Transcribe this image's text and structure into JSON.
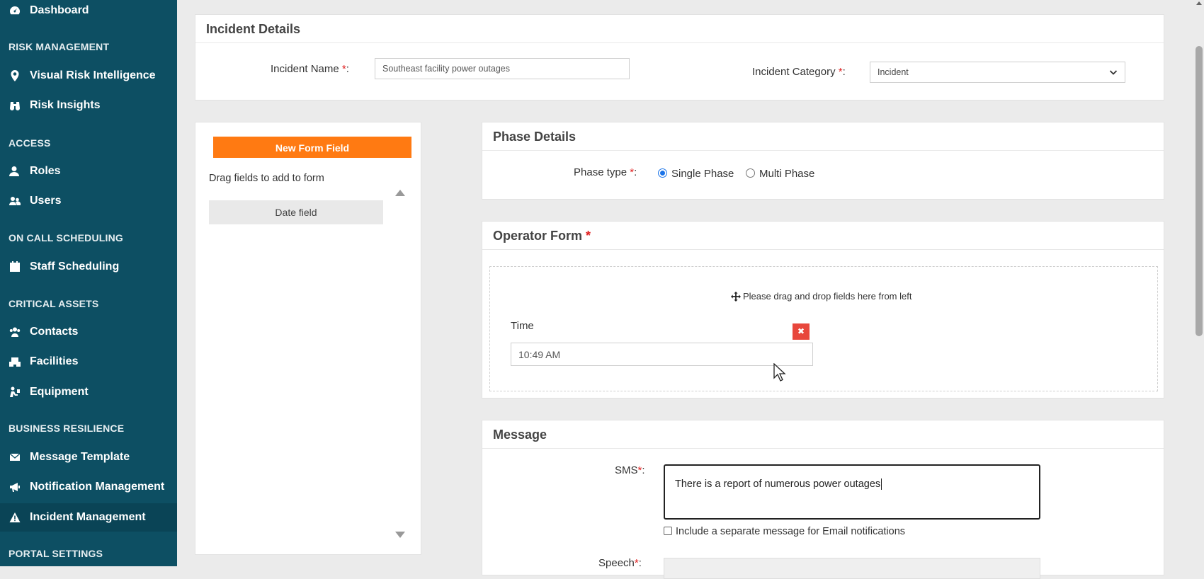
{
  "sidebar": {
    "items": [
      {
        "label": "Dashboard",
        "icon": "dashboard-icon"
      },
      {
        "label": "Visual Risk Intelligence",
        "icon": "map-pin-icon"
      },
      {
        "label": "Risk Insights",
        "icon": "binoculars-icon"
      },
      {
        "label": "Roles",
        "icon": "user-icon"
      },
      {
        "label": "Users",
        "icon": "users-icon"
      },
      {
        "label": "Staff Scheduling",
        "icon": "calendar-icon"
      },
      {
        "label": "Contacts",
        "icon": "contacts-icon"
      },
      {
        "label": "Facilities",
        "icon": "building-icon"
      },
      {
        "label": "Equipment",
        "icon": "equipment-icon"
      },
      {
        "label": "Message Template",
        "icon": "envelope-icon"
      },
      {
        "label": "Notification Management",
        "icon": "megaphone-icon"
      },
      {
        "label": "Incident Management",
        "icon": "warning-icon"
      }
    ],
    "sections": {
      "risk": "RISK MANAGEMENT",
      "access": "ACCESS",
      "oncall": "ON CALL SCHEDULING",
      "assets": "CRITICAL ASSETS",
      "resilience": "BUSINESS RESILIENCE",
      "portal": "PORTAL SETTINGS"
    }
  },
  "incident": {
    "title": "Incident Details",
    "name_label": "Incident Name",
    "name_value": "Southeast facility power outages",
    "category_label": "Incident Category",
    "category_value": "Incident",
    "required_mark": "*",
    "colon": ":"
  },
  "fields_panel": {
    "new_button": "New Form Field",
    "drag_hint": "Drag fields to add to form",
    "date_field": "Date field"
  },
  "phase": {
    "title": "Phase Details",
    "type_label": "Phase type",
    "options": [
      "Single Phase",
      "Multi Phase"
    ],
    "selected": "Single Phase"
  },
  "operator_form": {
    "title": "Operator Form",
    "drop_hint": "Please drag and drop fields here from left",
    "time_label": "Time",
    "time_value": "10:49 AM",
    "delete_glyph": "✖"
  },
  "message": {
    "title": "Message",
    "sms_label": "SMS",
    "sms_value": "There is a report of numerous power outages",
    "email_checkbox_label": "Include a separate message for Email notifications",
    "speech_label": "Speech"
  },
  "colors": {
    "sidebar_bg": "#0d4f63",
    "accent_orange": "#ff7a12",
    "required_red": "#e02020",
    "delete_red": "#e8473c",
    "radio_blue": "#1a73e8"
  }
}
